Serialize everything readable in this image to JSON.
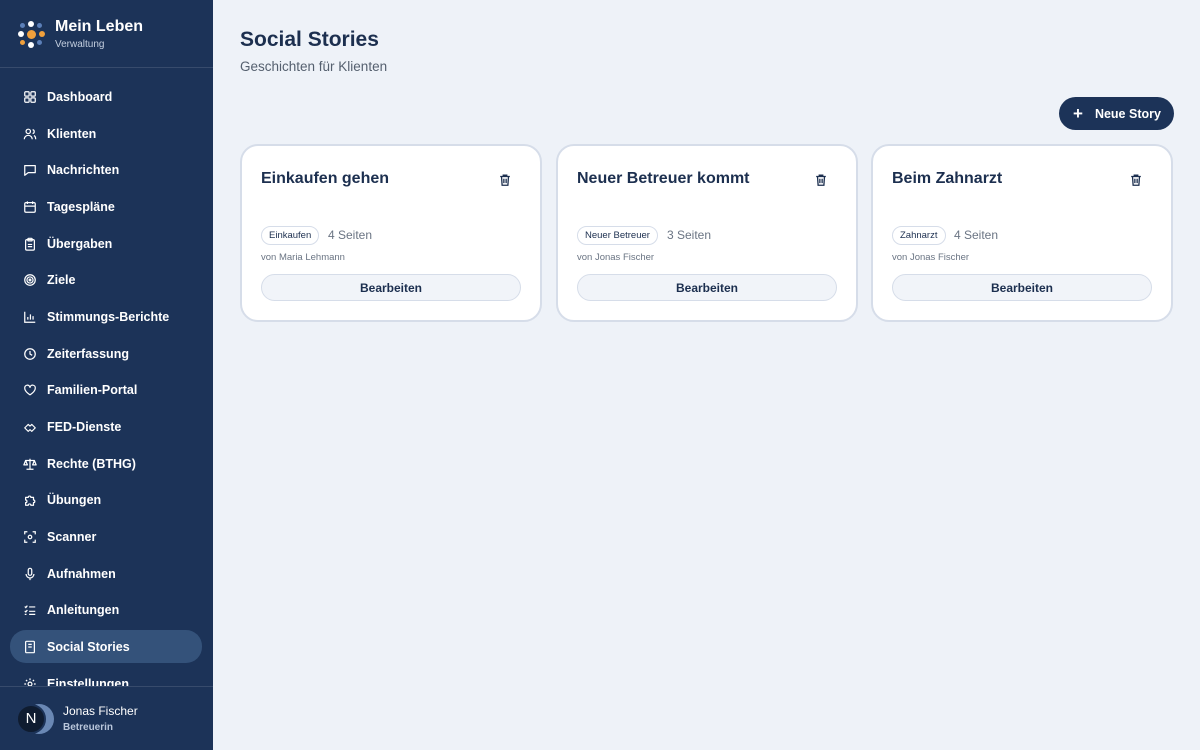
{
  "brand": {
    "title": "Mein Leben",
    "subtitle": "Verwaltung"
  },
  "nav": [
    {
      "label": "Dashboard",
      "icon": "dashboard-icon",
      "active": false
    },
    {
      "label": "Klienten",
      "icon": "users-icon",
      "active": false
    },
    {
      "label": "Nachrichten",
      "icon": "message-icon",
      "active": false
    },
    {
      "label": "Tagespläne",
      "icon": "calendar-icon",
      "active": false
    },
    {
      "label": "Übergaben",
      "icon": "clipboard-icon",
      "active": false
    },
    {
      "label": "Ziele",
      "icon": "target-icon",
      "active": false
    },
    {
      "label": "Stimmungs-Berichte",
      "icon": "bar-chart-icon",
      "active": false
    },
    {
      "label": "Zeiterfassung",
      "icon": "clock-icon",
      "active": false
    },
    {
      "label": "Familien-Portal",
      "icon": "heart-icon",
      "active": false
    },
    {
      "label": "FED-Dienste",
      "icon": "handshake-icon",
      "active": false
    },
    {
      "label": "Rechte (BTHG)",
      "icon": "scale-icon",
      "active": false
    },
    {
      "label": "Übungen",
      "icon": "puzzle-icon",
      "active": false
    },
    {
      "label": "Scanner",
      "icon": "scan-icon",
      "active": false
    },
    {
      "label": "Aufnahmen",
      "icon": "microphone-icon",
      "active": false
    },
    {
      "label": "Anleitungen",
      "icon": "checklist-icon",
      "active": false
    },
    {
      "label": "Social Stories",
      "icon": "book-icon",
      "active": true
    },
    {
      "label": "Einstellungen",
      "icon": "gear-icon",
      "active": false
    }
  ],
  "user": {
    "initial": "N",
    "name": "Jonas Fischer",
    "role": "Betreuerin"
  },
  "header": {
    "title": "Social Stories",
    "subtitle": "Geschichten für Klienten"
  },
  "new_story_button": {
    "label": "Neue Story",
    "icon": "plus-icon"
  },
  "cards": [
    {
      "title": "Einkaufen gehen",
      "tag": "Einkaufen",
      "pages": "4 Seiten",
      "author": "von Maria Lehmann",
      "edit_label": "Bearbeiten"
    },
    {
      "title": "Neuer Betreuer kommt",
      "tag": "Neuer Betreuer",
      "pages": "3 Seiten",
      "author": "von Jonas Fischer",
      "edit_label": "Bearbeiten"
    },
    {
      "title": "Beim Zahnarzt",
      "tag": "Zahnarzt",
      "pages": "4 Seiten",
      "author": "von Jonas Fischer",
      "edit_label": "Bearbeiten"
    }
  ],
  "colors": {
    "sidebar": "#1c3358",
    "sidebar_active": "#34527a",
    "background": "#eef2f8",
    "primary": "#1c3358",
    "logo_orange": "#f0a03c",
    "logo_blue": "#5b7fb8"
  }
}
